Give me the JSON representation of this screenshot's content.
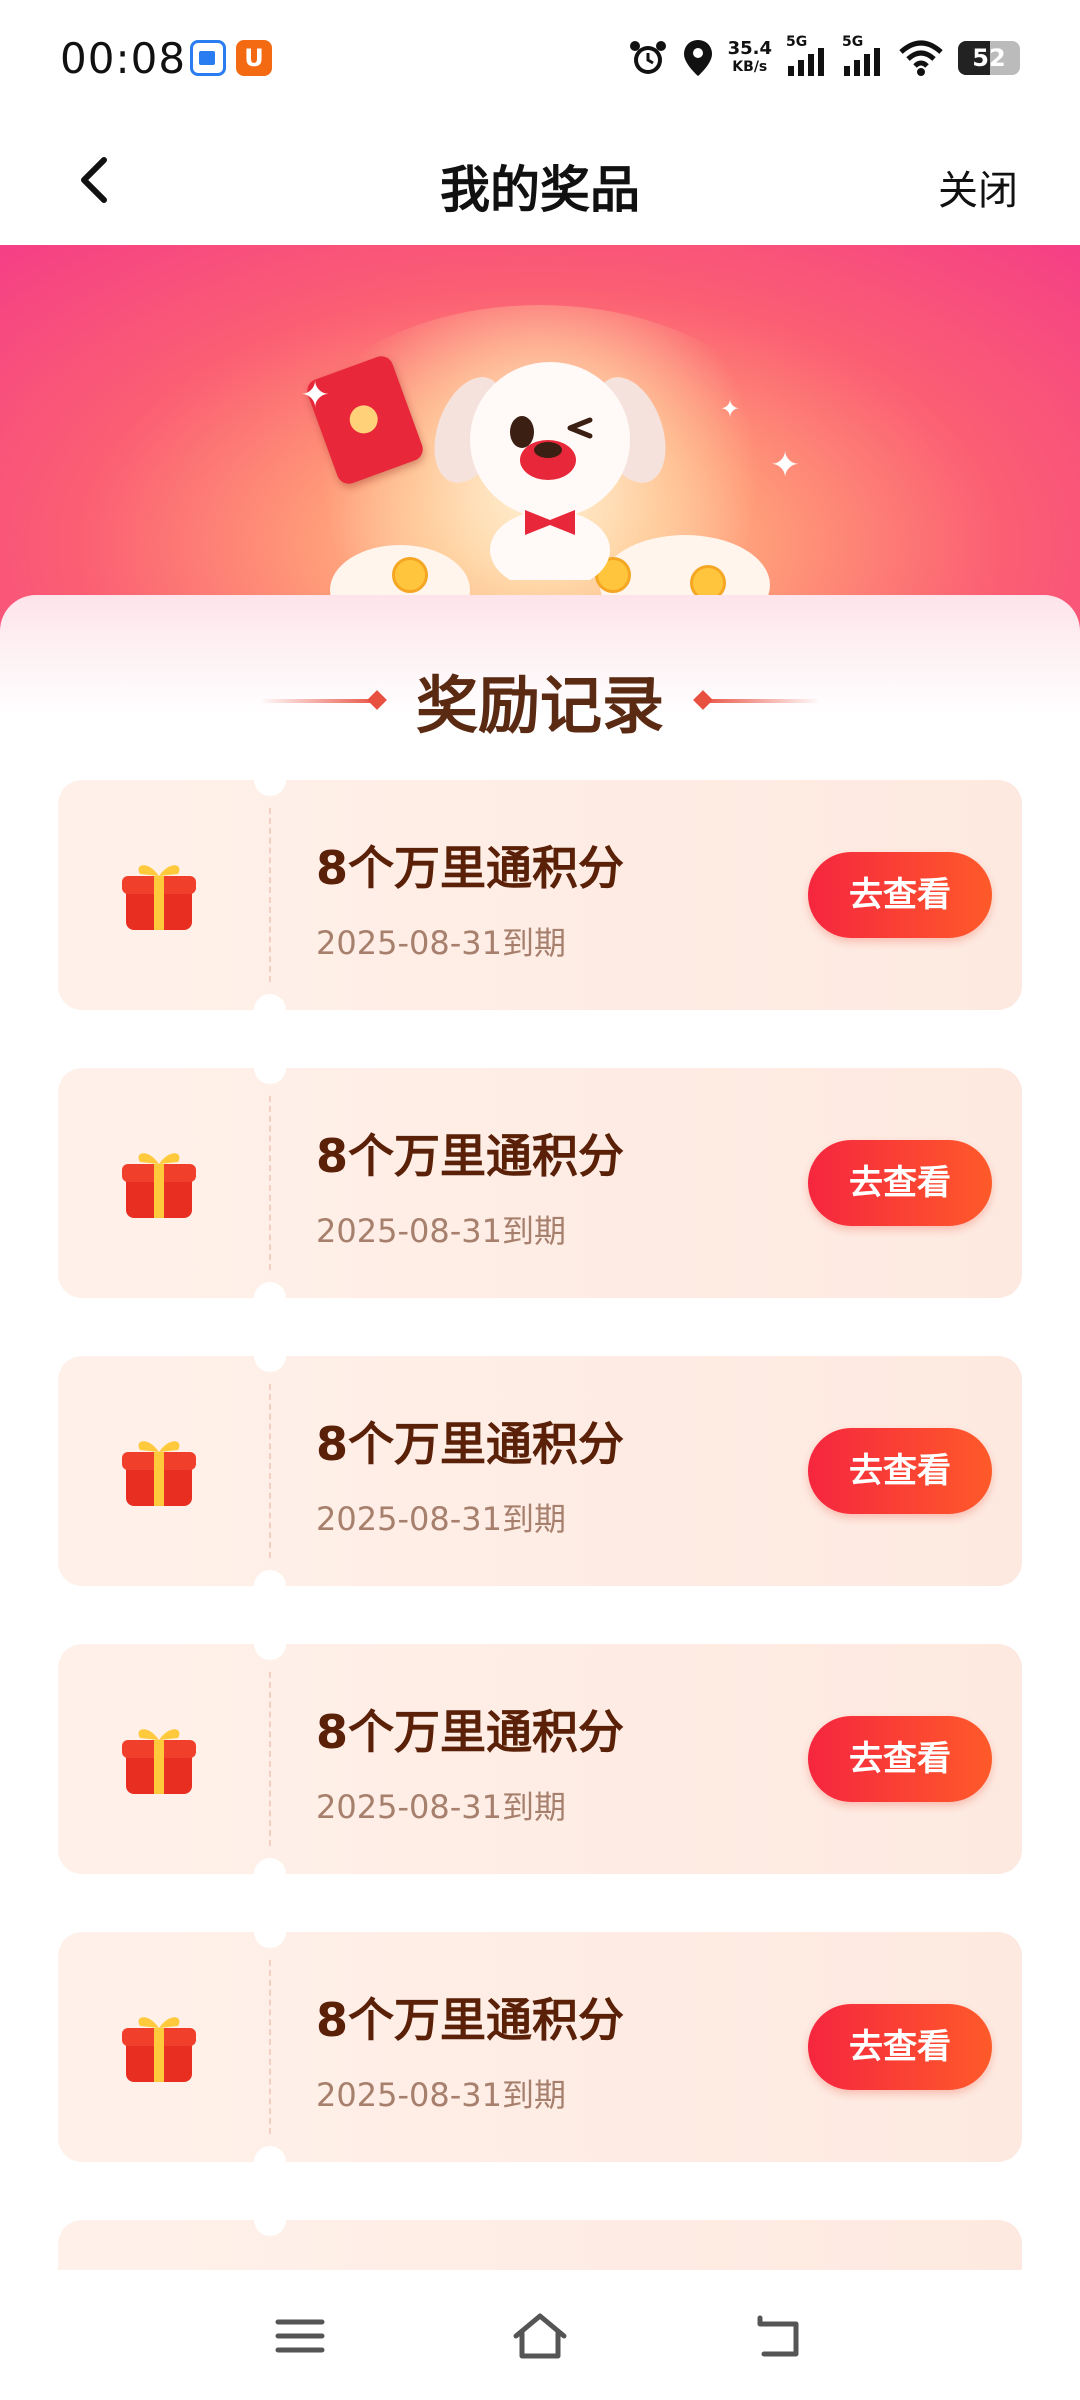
{
  "status_bar": {
    "time": "00:08",
    "net_speed_value": "35.4",
    "net_speed_unit": "KB/s",
    "signal1_label": "5G",
    "signal2_label": "5G",
    "battery_level": "52"
  },
  "header": {
    "title": "我的奖品",
    "close_label": "关闭"
  },
  "section": {
    "title": "奖励记录"
  },
  "rewards": [
    {
      "name": "8个万里通积分",
      "expiry": "2025-08-31到期",
      "action": "去查看"
    },
    {
      "name": "8个万里通积分",
      "expiry": "2025-08-31到期",
      "action": "去查看"
    },
    {
      "name": "8个万里通积分",
      "expiry": "2025-08-31到期",
      "action": "去查看"
    },
    {
      "name": "8个万里通积分",
      "expiry": "2025-08-31到期",
      "action": "去查看"
    },
    {
      "name": "8个万里通积分",
      "expiry": "2025-08-31到期",
      "action": "去查看"
    }
  ],
  "colors": {
    "accent": "#f5263f",
    "prize_text": "#5a2108",
    "card_bg": "#fff1ea"
  }
}
